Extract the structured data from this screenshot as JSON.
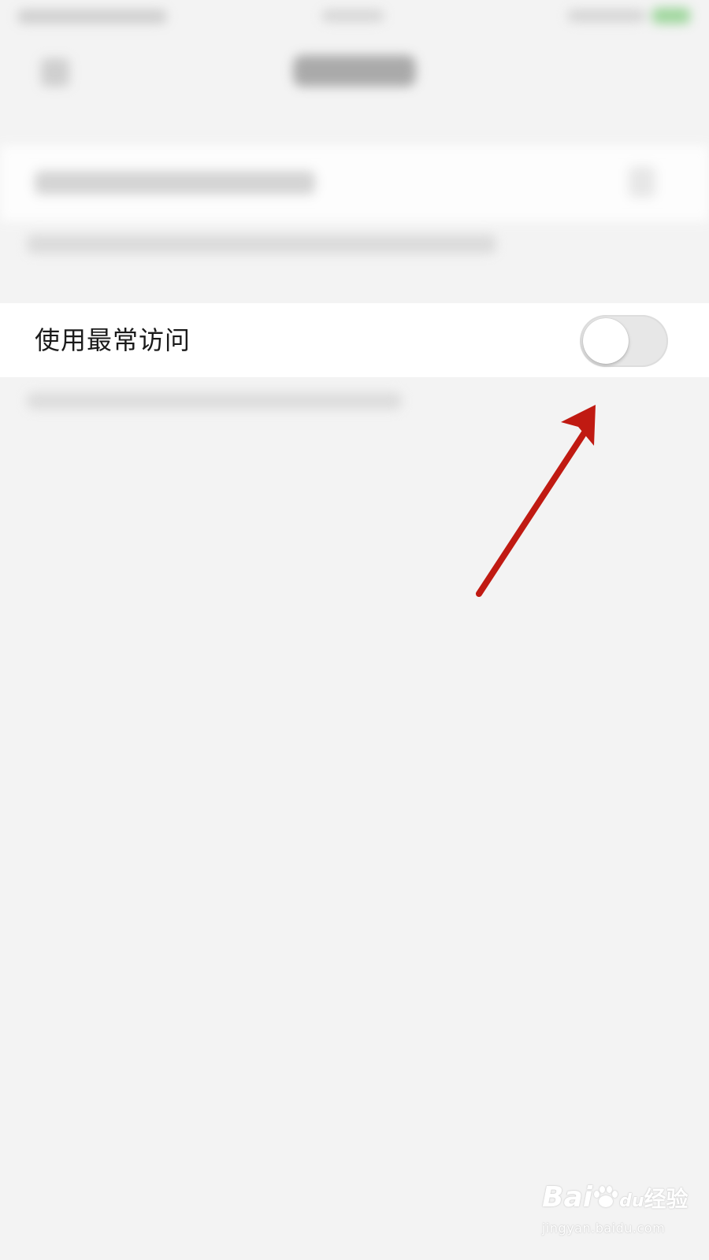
{
  "setting": {
    "label": "使用最常访问",
    "toggle_on": false
  },
  "colors": {
    "background": "#f3f3f3",
    "row_background": "#ffffff",
    "toggle_track_off": "#e7e7e7",
    "annotation_arrow": "#c01a12"
  },
  "watermark": {
    "logo_text_1": "Bai",
    "logo_text_2": "经验",
    "logo_du": "du",
    "url": "jingyan.baidu.com"
  }
}
